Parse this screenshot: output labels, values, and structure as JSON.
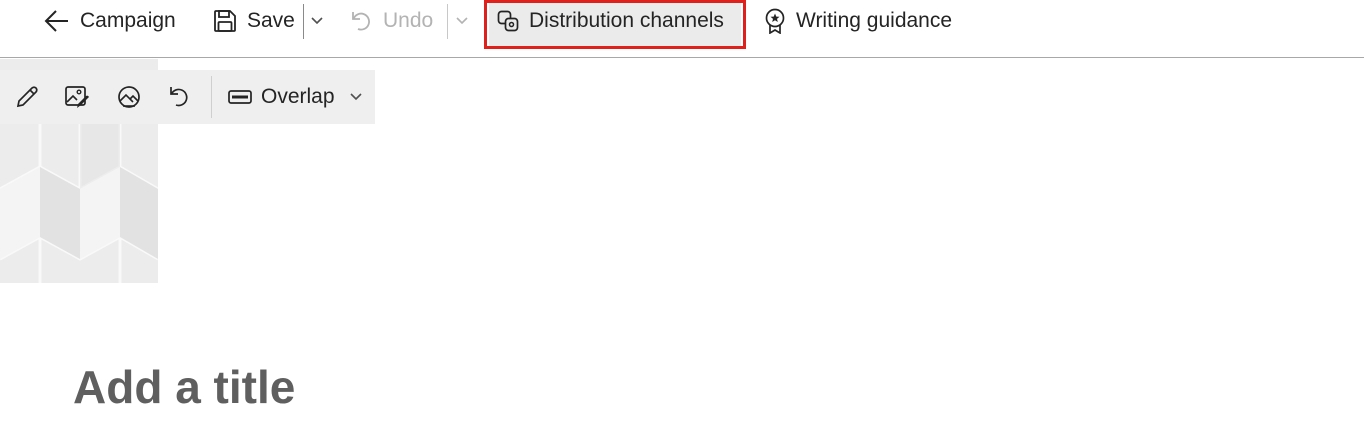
{
  "command_bar": {
    "back_label": "Campaign",
    "save_label": "Save",
    "undo_label": "Undo",
    "distribution_label": "Distribution channels",
    "writing_guidance_label": "Writing guidance"
  },
  "image_toolbar": {
    "layout_label": "Overlap"
  },
  "page": {
    "title_placeholder": "Add a title"
  },
  "colors": {
    "highlight_border": "#e0201b",
    "hero_background": "#ececec"
  }
}
